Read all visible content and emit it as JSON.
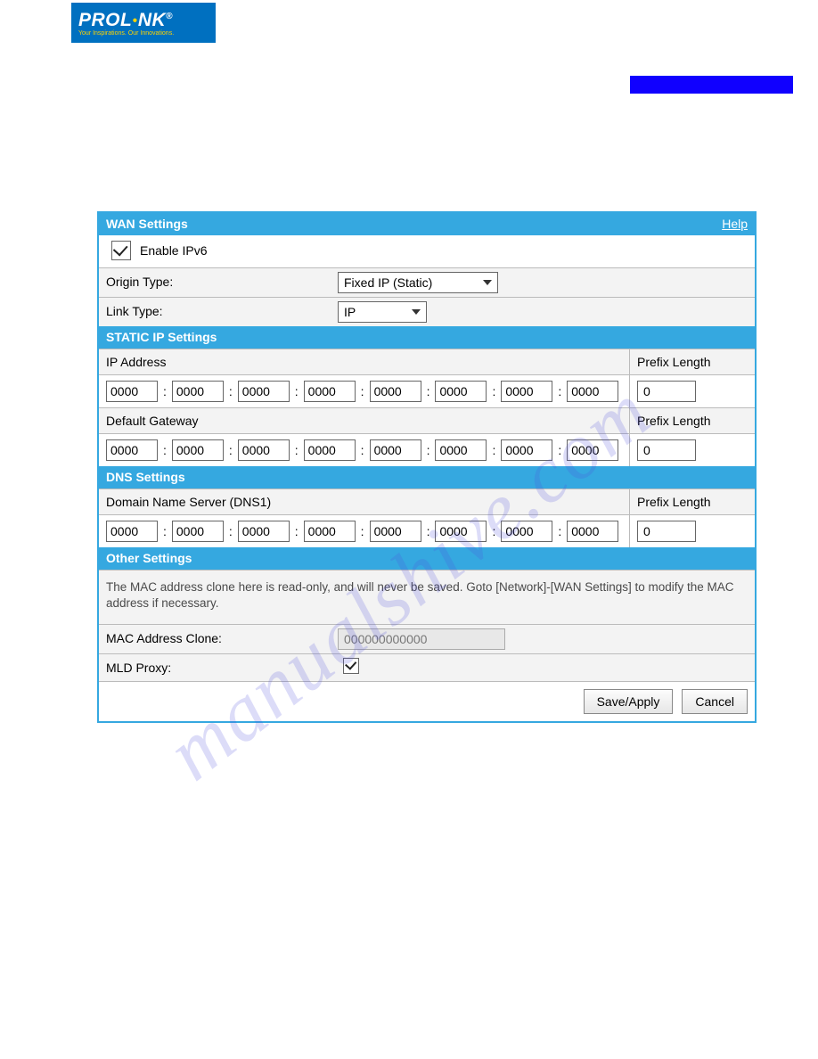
{
  "logo": {
    "brand": "PROL",
    "brand2": "NK",
    "reg": "®",
    "tagline": "Your Inspirations. Our Innovations."
  },
  "wan": {
    "title": "WAN Settings",
    "help": "Help",
    "enable_label": "Enable IPv6",
    "enable_checked": true,
    "origin_label": "Origin Type:",
    "origin_value": "Fixed IP (Static)",
    "link_label": "Link Type:",
    "link_value": "IP"
  },
  "static": {
    "title": "STATIC IP Settings",
    "ip_label": "IP Address",
    "prefix_label": "Prefix Length",
    "ip_octets": [
      "0000",
      "0000",
      "0000",
      "0000",
      "0000",
      "0000",
      "0000",
      "0000"
    ],
    "ip_prefix": "0",
    "gw_label": "Default Gateway",
    "gw_octets": [
      "0000",
      "0000",
      "0000",
      "0000",
      "0000",
      "0000",
      "0000",
      "0000"
    ],
    "gw_prefix": "0"
  },
  "dns": {
    "title": "DNS Settings",
    "dns1_label": "Domain Name Server (DNS1)",
    "prefix_label": "Prefix Length",
    "dns1_octets": [
      "0000",
      "0000",
      "0000",
      "0000",
      "0000",
      "0000",
      "0000",
      "0000"
    ],
    "dns1_prefix": "0"
  },
  "other": {
    "title": "Other Settings",
    "note": "The MAC address clone here is read-only, and will never be saved. Goto [Network]-[WAN Settings] to modify the MAC address if necessary.",
    "mac_label": "MAC Address Clone:",
    "mac_value": "000000000000",
    "mld_label": "MLD Proxy:",
    "mld_checked": true
  },
  "buttons": {
    "save": "Save/Apply",
    "cancel": "Cancel"
  },
  "watermark": "manualshive.com"
}
